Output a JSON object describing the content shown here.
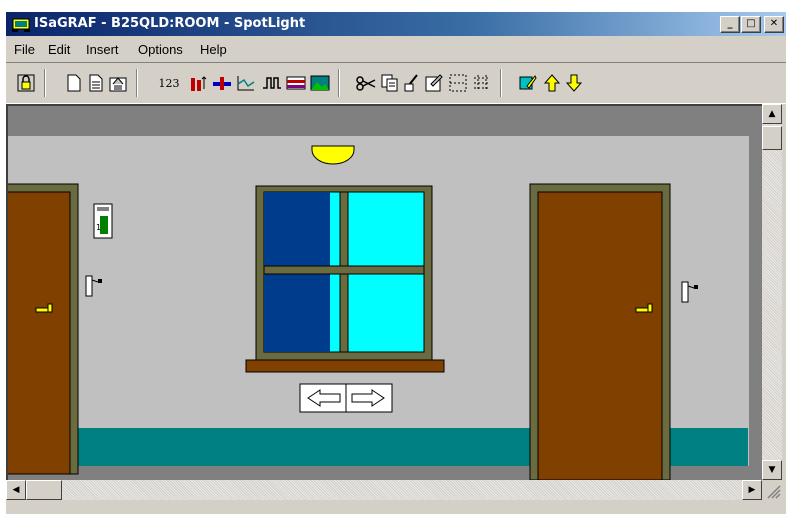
{
  "window": {
    "title": "ISaGRAF - B25QLD:ROOM - SpotLight",
    "minimize_label": "_",
    "maximize_label": "□",
    "close_label": "✕"
  },
  "menu": {
    "items": [
      "File",
      "Edit",
      "Insert",
      "Options",
      "Help"
    ]
  },
  "toolbar": {
    "counter_label": "123",
    "tools": [
      "lock-icon",
      "new-document-icon",
      "document-icon",
      "save-icon",
      "numeric-value-icon",
      "bargraph-icon",
      "slider-icon",
      "trend-icon",
      "digital-signal-icon",
      "table-icon",
      "bitmap-icon",
      "cut-icon",
      "copy-icon",
      "paint-icon",
      "properties-icon",
      "select-grid-icon",
      "align-grid-icon",
      "edit-icon",
      "move-up-icon",
      "move-down-icon"
    ]
  },
  "scene": {
    "colors": {
      "wall": "#c0c0c0",
      "ceiling": "#808080",
      "floor": "#008080",
      "door": "#804000",
      "frame": "#6b6b40",
      "glass": "#00ffff",
      "blind": "#003c8c",
      "lamp": "#ffff00"
    },
    "blind_level": 0.73,
    "nav_left_label": "⇦",
    "nav_right_label": "⇨"
  }
}
